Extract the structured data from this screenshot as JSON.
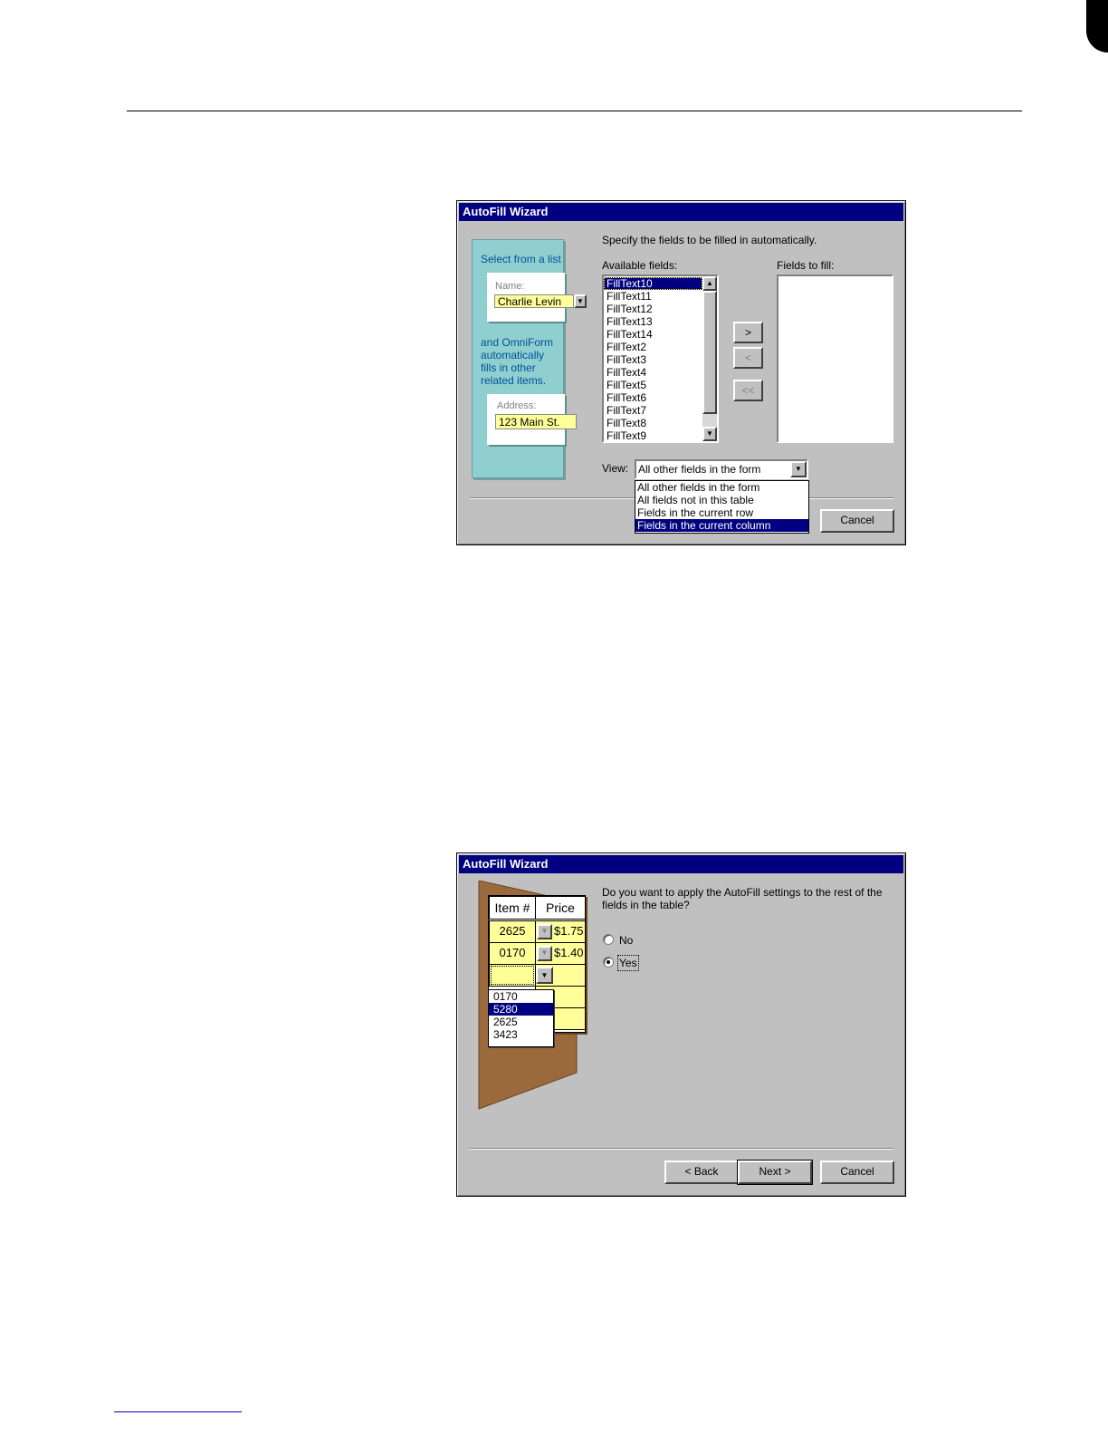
{
  "dialog1": {
    "title": "AutoFill Wizard",
    "instruction": "Specify the fields to be filled in automatically.",
    "illustration": {
      "heading": "Select from a list",
      "name_label": "Name:",
      "name_value": "Charlie Levin",
      "caption_lines": [
        "and OmniForm",
        "automatically",
        "fills in other",
        "related items."
      ],
      "address_label": "Address:",
      "address_value": "123 Main St."
    },
    "available_label": "Available fields:",
    "available_fields": [
      "FillText10",
      "FillText11",
      "FillText12",
      "FillText13",
      "FillText14",
      "FillText2",
      "FillText3",
      "FillText4",
      "FillText5",
      "FillText6",
      "FillText7",
      "FillText8",
      "FillText9"
    ],
    "selected_field": "FillText10",
    "fill_label": "Fields to fill:",
    "add_label": ">",
    "remove_label": "<",
    "remove_all_label": "<<",
    "view_label": "View:",
    "view_value": "All other fields in the form",
    "view_options": [
      "All other fields in the form",
      "All fields not in this table",
      "Fields in the current row",
      "Fields in the current column"
    ],
    "view_highlighted": "Fields in the current column",
    "cancel_label": "Cancel"
  },
  "dialog2": {
    "title": "AutoFill Wizard",
    "question": [
      "Do you want to apply the AutoFill settings to the rest of the",
      "fields in the table?"
    ],
    "option_no": "No",
    "option_yes": "Yes",
    "selected_option": "Yes",
    "table": {
      "headers": [
        "Item #",
        "Price"
      ],
      "rows": [
        [
          "2625",
          "$1.75"
        ],
        [
          "0170",
          "$1.40"
        ]
      ],
      "dropdown_options": [
        "0170",
        "5280",
        "2625",
        "3423"
      ],
      "dropdown_highlighted": "5280"
    },
    "back_label": "< Back",
    "next_label": "Next >",
    "cancel_label": "Cancel"
  },
  "colors": {
    "titlebar": "#000080",
    "dialog_face": "#c0c0c0",
    "illustration_teal": "#8fcfcf",
    "field_yellow": "#ffff99",
    "folder_brown": "#9a6a3c"
  }
}
